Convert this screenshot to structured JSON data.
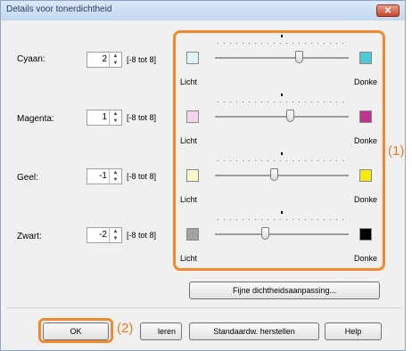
{
  "window": {
    "title": "Details voor tonerdichtheid",
    "close_label": "✕"
  },
  "rows": [
    {
      "label": "Cyaan:",
      "value": "2",
      "range": "[-8 tot 8]",
      "level": 2,
      "color": "#4fc9d6"
    },
    {
      "label": "Magenta:",
      "value": "1",
      "range": "[-8 tot 8]",
      "level": 1,
      "color": "#c2358f"
    },
    {
      "label": "Geel:",
      "value": "-1",
      "range": "[-8 tot 8]",
      "level": -1,
      "color": "#f3ea12"
    },
    {
      "label": "Zwart:",
      "value": "-2",
      "range": "[-8 tot 8]",
      "level": -2,
      "color": "#000000"
    }
  ],
  "light_colors": [
    "#dff4f7",
    "#f4d4eb",
    "#fbf8c9",
    "#a3a3a3"
  ],
  "scale": {
    "light": "Licht",
    "dark": "Donke"
  },
  "buttons": {
    "fine": "Fijne dichtheidsaanpassing...",
    "ok": "OK",
    "annuleren": "leren",
    "defaults": "Standaardw. herstellen",
    "help": "Help"
  },
  "callouts": {
    "one": "(1)",
    "two": "(2)"
  }
}
